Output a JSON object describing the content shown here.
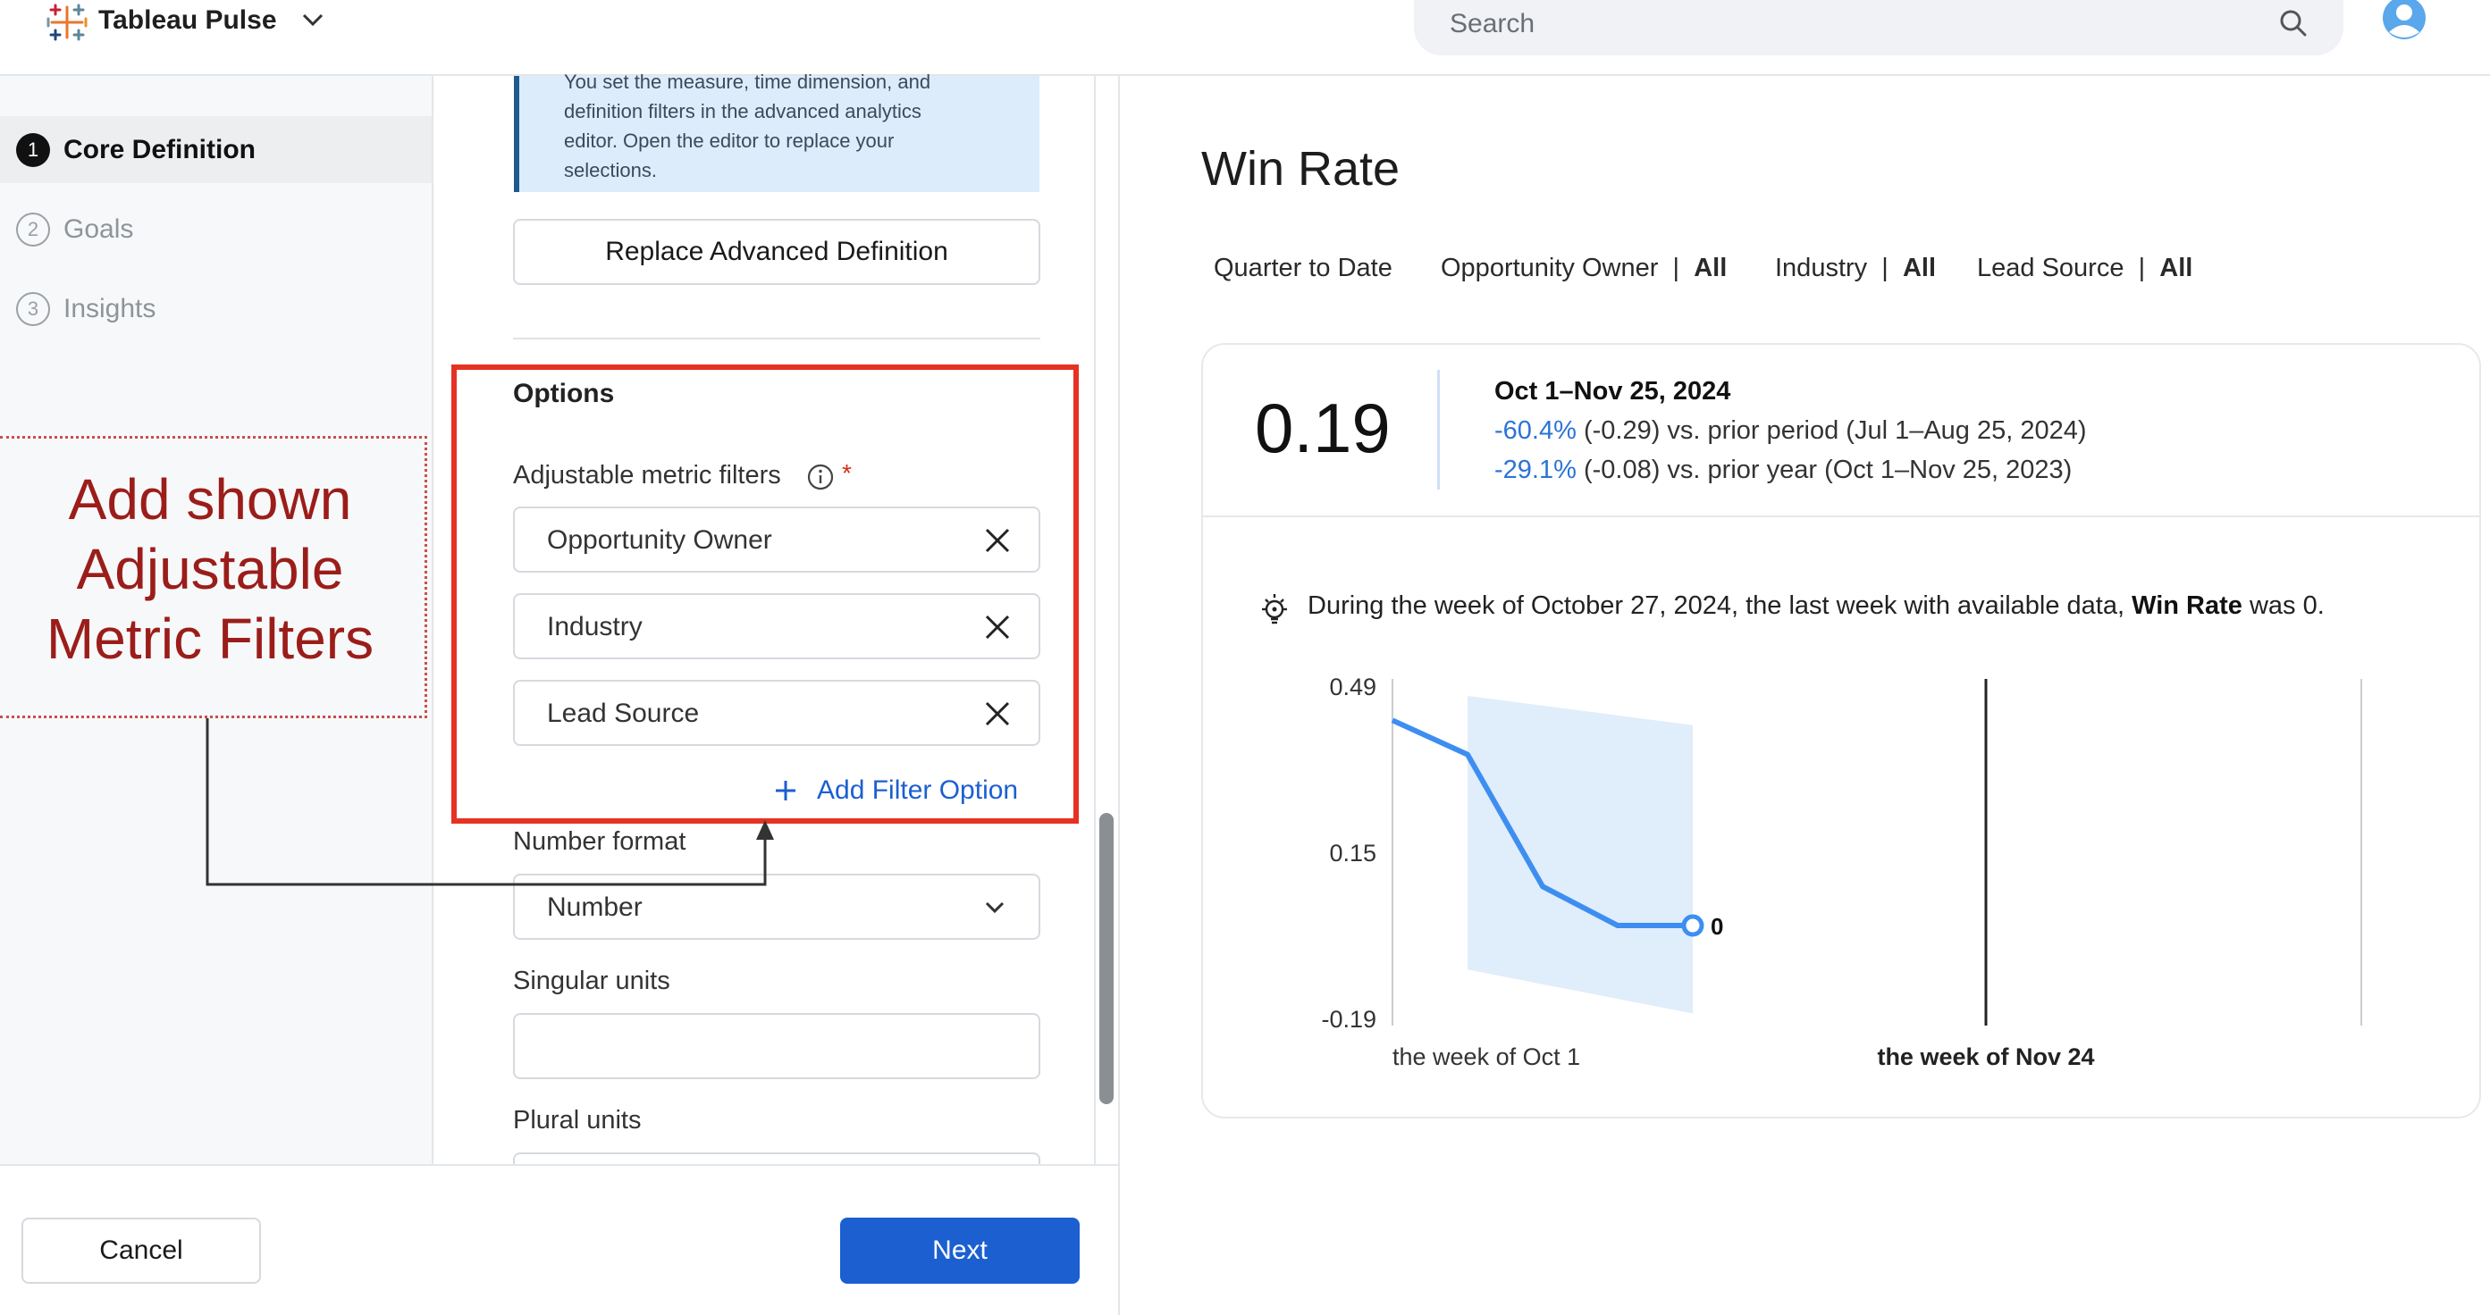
{
  "topbar": {
    "app_name": "Tableau Pulse",
    "search_placeholder": "Search"
  },
  "steps": [
    {
      "num": "1",
      "label": "Core Definition",
      "active": true
    },
    {
      "num": "2",
      "label": "Goals",
      "active": false
    },
    {
      "num": "3",
      "label": "Insights",
      "active": false
    }
  ],
  "annotation": {
    "lines": [
      "Add shown",
      "Adjustable",
      "Metric Filters"
    ],
    "color": "#9b1d1a"
  },
  "form": {
    "info_lines": [
      "You set the measure, time dimension, and",
      "definition filters in the advanced analytics",
      "editor. Open the editor to replace your",
      "selections."
    ],
    "replace_button": "Replace Advanced Definition",
    "options_title": "Options",
    "filters_label": "Adjustable metric filters",
    "required_mark": "*",
    "filters": [
      "Opportunity Owner",
      "Industry",
      "Lead Source"
    ],
    "add_filter": "Add Filter Option",
    "number_format_label": "Number format",
    "number_format_value": "Number",
    "singular_units_label": "Singular units",
    "singular_units_value": "",
    "plural_units_label": "Plural units"
  },
  "footer": {
    "cancel": "Cancel",
    "next": "Next"
  },
  "metric": {
    "title": "Win Rate",
    "time_filter": "Quarter to Date",
    "filters": [
      {
        "name": "Opportunity Owner",
        "sep": "|",
        "value": "All"
      },
      {
        "name": "Industry",
        "sep": "|",
        "value": "All"
      },
      {
        "name": "Lead Source",
        "sep": "|",
        "value": "All"
      }
    ],
    "value": "0.19",
    "period": "Oct 1–Nov 25, 2024",
    "comparisons": [
      {
        "pct": "-60.4%",
        "rest": "(-0.29) vs. prior period (Jul 1–Aug 25, 2024)"
      },
      {
        "pct": "-29.1%",
        "rest": "(-0.08) vs. prior year (Oct 1–Nov 25, 2023)"
      }
    ],
    "insight_pre": "During the week of October 27, 2024, the last week with available data,",
    "insight_bold": "Win Rate",
    "insight_post": "was 0."
  },
  "chart_data": {
    "type": "line",
    "title": "",
    "y_ticks": [
      "0.49",
      "0.15",
      "-0.19"
    ],
    "ylim": [
      -0.19,
      0.49
    ],
    "x_labels": [
      "the week of Oct 1",
      "the week of Nov 24"
    ],
    "series": [
      {
        "values": [
          0.42,
          0.35,
          0.08,
          0.0,
          0.0
        ]
      }
    ],
    "band_upper": [
      null,
      0.47,
      0.45,
      0.43,
      0.41
    ],
    "band_lower": [
      null,
      -0.09,
      -0.12,
      -0.15,
      -0.18
    ],
    "last_label": "0",
    "colors": {
      "line": "#3d8ef0",
      "band": "#e0edfb"
    }
  }
}
